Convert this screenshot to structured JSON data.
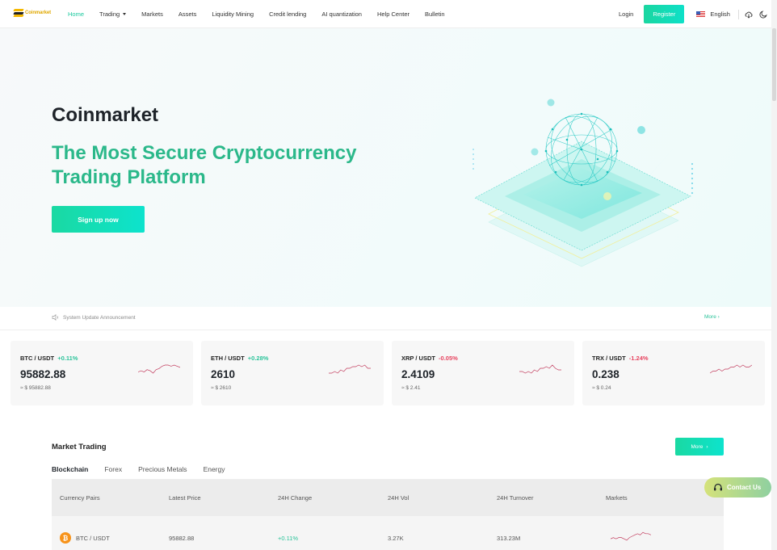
{
  "header": {
    "logo_text": "Coinmarket",
    "nav": [
      {
        "label": "Home",
        "active": true
      },
      {
        "label": "Trading",
        "dropdown": true
      },
      {
        "label": "Markets"
      },
      {
        "label": "Assets"
      },
      {
        "label": "Liquidity Mining"
      },
      {
        "label": "Credit lending"
      },
      {
        "label": "AI quantization"
      },
      {
        "label": "Help Center"
      },
      {
        "label": "Bulletin"
      }
    ],
    "login_label": "Login",
    "register_label": "Register",
    "language": "English",
    "icons": [
      "download-icon",
      "dark-mode-moon-icon"
    ]
  },
  "hero": {
    "brand": "Coinmarket",
    "tagline": "The Most Secure Cryptocurrency Trading Platform",
    "signup_label": "Sign up now"
  },
  "announcement": {
    "text": "System Update Announcement",
    "more_label": "More ›"
  },
  "tickers": [
    {
      "pair": "BTC / USDT",
      "change": "+0.11%",
      "direction": "up",
      "price": "95882.88",
      "usd": "≈ $ 95882.88",
      "spark": [
        3,
        4,
        3,
        5,
        4,
        2,
        5,
        6,
        8,
        9,
        9,
        8,
        9,
        8,
        7
      ]
    },
    {
      "pair": "ETH / USDT",
      "change": "+0.28%",
      "direction": "up",
      "price": "2610",
      "usd": "≈ $ 2610",
      "spark": [
        3,
        3,
        4,
        3,
        5,
        4,
        6,
        6,
        7,
        7,
        8,
        7,
        8,
        6,
        6
      ]
    },
    {
      "pair": "XRP / USDT",
      "change": "-0.05%",
      "direction": "down",
      "price": "2.4109",
      "usd": "≈ $ 2.41",
      "spark": [
        4,
        4,
        3,
        4,
        3,
        5,
        4,
        6,
        6,
        7,
        6,
        8,
        6,
        5,
        5
      ]
    },
    {
      "pair": "TRX / USDT",
      "change": "-1.24%",
      "direction": "down",
      "price": "0.238",
      "usd": "≈ $ 0.24",
      "spark": [
        3,
        4,
        4,
        5,
        4,
        5,
        5,
        6,
        6,
        7,
        6,
        7,
        6,
        6,
        7
      ]
    }
  ],
  "market": {
    "title": "Market Trading",
    "more_label": "More",
    "tabs": [
      {
        "label": "Blockchain",
        "active": true
      },
      {
        "label": "Forex"
      },
      {
        "label": "Precious Metals"
      },
      {
        "label": "Energy"
      }
    ],
    "columns": [
      "Currency Pairs",
      "Latest Price",
      "24H Change",
      "24H Vol",
      "24H Turnover",
      "Markets"
    ],
    "rows": [
      {
        "pair": "BTC / USDT",
        "icon": "bitcoin-icon",
        "price": "95882.88",
        "change": "+0.11%",
        "direction": "up",
        "vol": "3.27K",
        "turnover": "313.23M",
        "spark": [
          3,
          4,
          3,
          4,
          4,
          3,
          2,
          4,
          5,
          6,
          7,
          6,
          8,
          7,
          7,
          6
        ]
      }
    ]
  },
  "contact": {
    "label": "Contact Us"
  },
  "colors": {
    "accent": "#1ad6a0",
    "up": "#2bc39a",
    "down": "#e7435f",
    "spark": "#c23a5c"
  }
}
